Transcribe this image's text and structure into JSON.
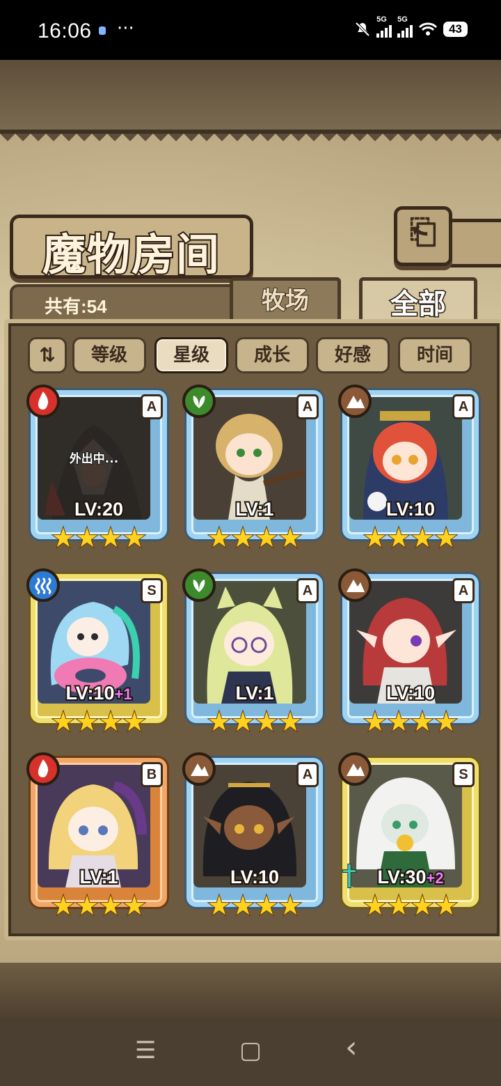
{
  "status_bar": {
    "time": "16:06",
    "more": "···",
    "signal1_label": "5G",
    "signal2_label": "5G",
    "battery": "43"
  },
  "header": {
    "title": "魔物房间",
    "back_icon": "⎗"
  },
  "count_label": "共有:54",
  "tabs": [
    {
      "label": "牧场"
    },
    {
      "label": "全部",
      "selected": true
    }
  ],
  "sort": {
    "toggle_label": "⇅",
    "buttons": [
      {
        "label": "等级"
      },
      {
        "label": "星级",
        "active": true
      },
      {
        "label": "成长"
      },
      {
        "label": "好感"
      },
      {
        "label": "时间"
      }
    ]
  },
  "monsters": [
    {
      "element": "fire",
      "rank": "A",
      "level": "LV:20",
      "plus": "",
      "stars": "★★★★",
      "status": "外出中..."
    },
    {
      "element": "leaf",
      "rank": "A",
      "level": "LV:1",
      "plus": "",
      "stars": "★★★★"
    },
    {
      "element": "earth",
      "rank": "A",
      "level": "LV:10",
      "plus": "",
      "stars": "★★★★"
    },
    {
      "element": "water",
      "rank": "S",
      "level": "LV:10",
      "plus": "+1",
      "stars": "★★★★"
    },
    {
      "element": "leaf",
      "rank": "A",
      "level": "LV:1",
      "plus": "",
      "stars": "★★★★"
    },
    {
      "element": "earth",
      "rank": "A",
      "level": "LV:10",
      "plus": "",
      "stars": "★★★★"
    },
    {
      "element": "fire",
      "rank": "B",
      "level": "LV:1",
      "plus": "",
      "stars": "★★★★"
    },
    {
      "element": "earth",
      "rank": "A",
      "level": "LV:10",
      "plus": "",
      "stars": "★★★★"
    },
    {
      "element": "earth",
      "rank": "S",
      "level": "LV:30",
      "plus": "+2",
      "stars": "★★★★"
    }
  ],
  "nav": {
    "menu": "☰",
    "home": "▢",
    "back": "‹"
  },
  "colors": {
    "fire": "#d7312b",
    "leaf": "#3c8a2c",
    "earth": "#8a5a38",
    "water": "#2c7ad2",
    "star": "#ffd21f",
    "plus": "#f07aff"
  }
}
